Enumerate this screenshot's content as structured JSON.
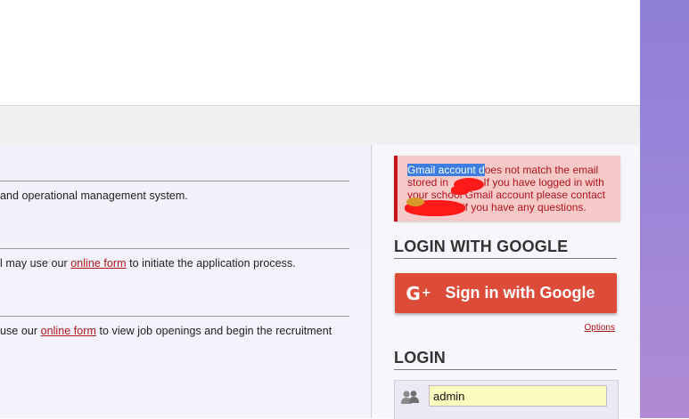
{
  "sections": [
    {
      "text_before": "and operational management system.",
      "link": "",
      "text_after": ""
    },
    {
      "text_before": "l may use our ",
      "link": "online form",
      "text_after": " to initiate the application process."
    },
    {
      "text_before": "use our ",
      "link": "online form",
      "text_after": " to view job openings and begin the recruitment"
    }
  ],
  "alert": {
    "highlighted": "Gmail account d",
    "line1_rest": "oes not match the email",
    "line2_a": "stored in",
    "line2_b": "If you have logged in with",
    "line3": "your school Gmail account please contact",
    "line4": "if you have any questions."
  },
  "google_heading": "LOGIN WITH GOOGLE",
  "google_button": {
    "icon": "G+",
    "label": "Sign in with Google"
  },
  "options_link": "Options",
  "login_heading": "LOGIN",
  "username": {
    "value": "admin",
    "icon": "users-icon"
  },
  "colors": {
    "accent_red": "#dd4b39",
    "link_red": "#b0151a",
    "alert_bg": "#f6c9c9",
    "input_bg": "#fafcbf"
  }
}
